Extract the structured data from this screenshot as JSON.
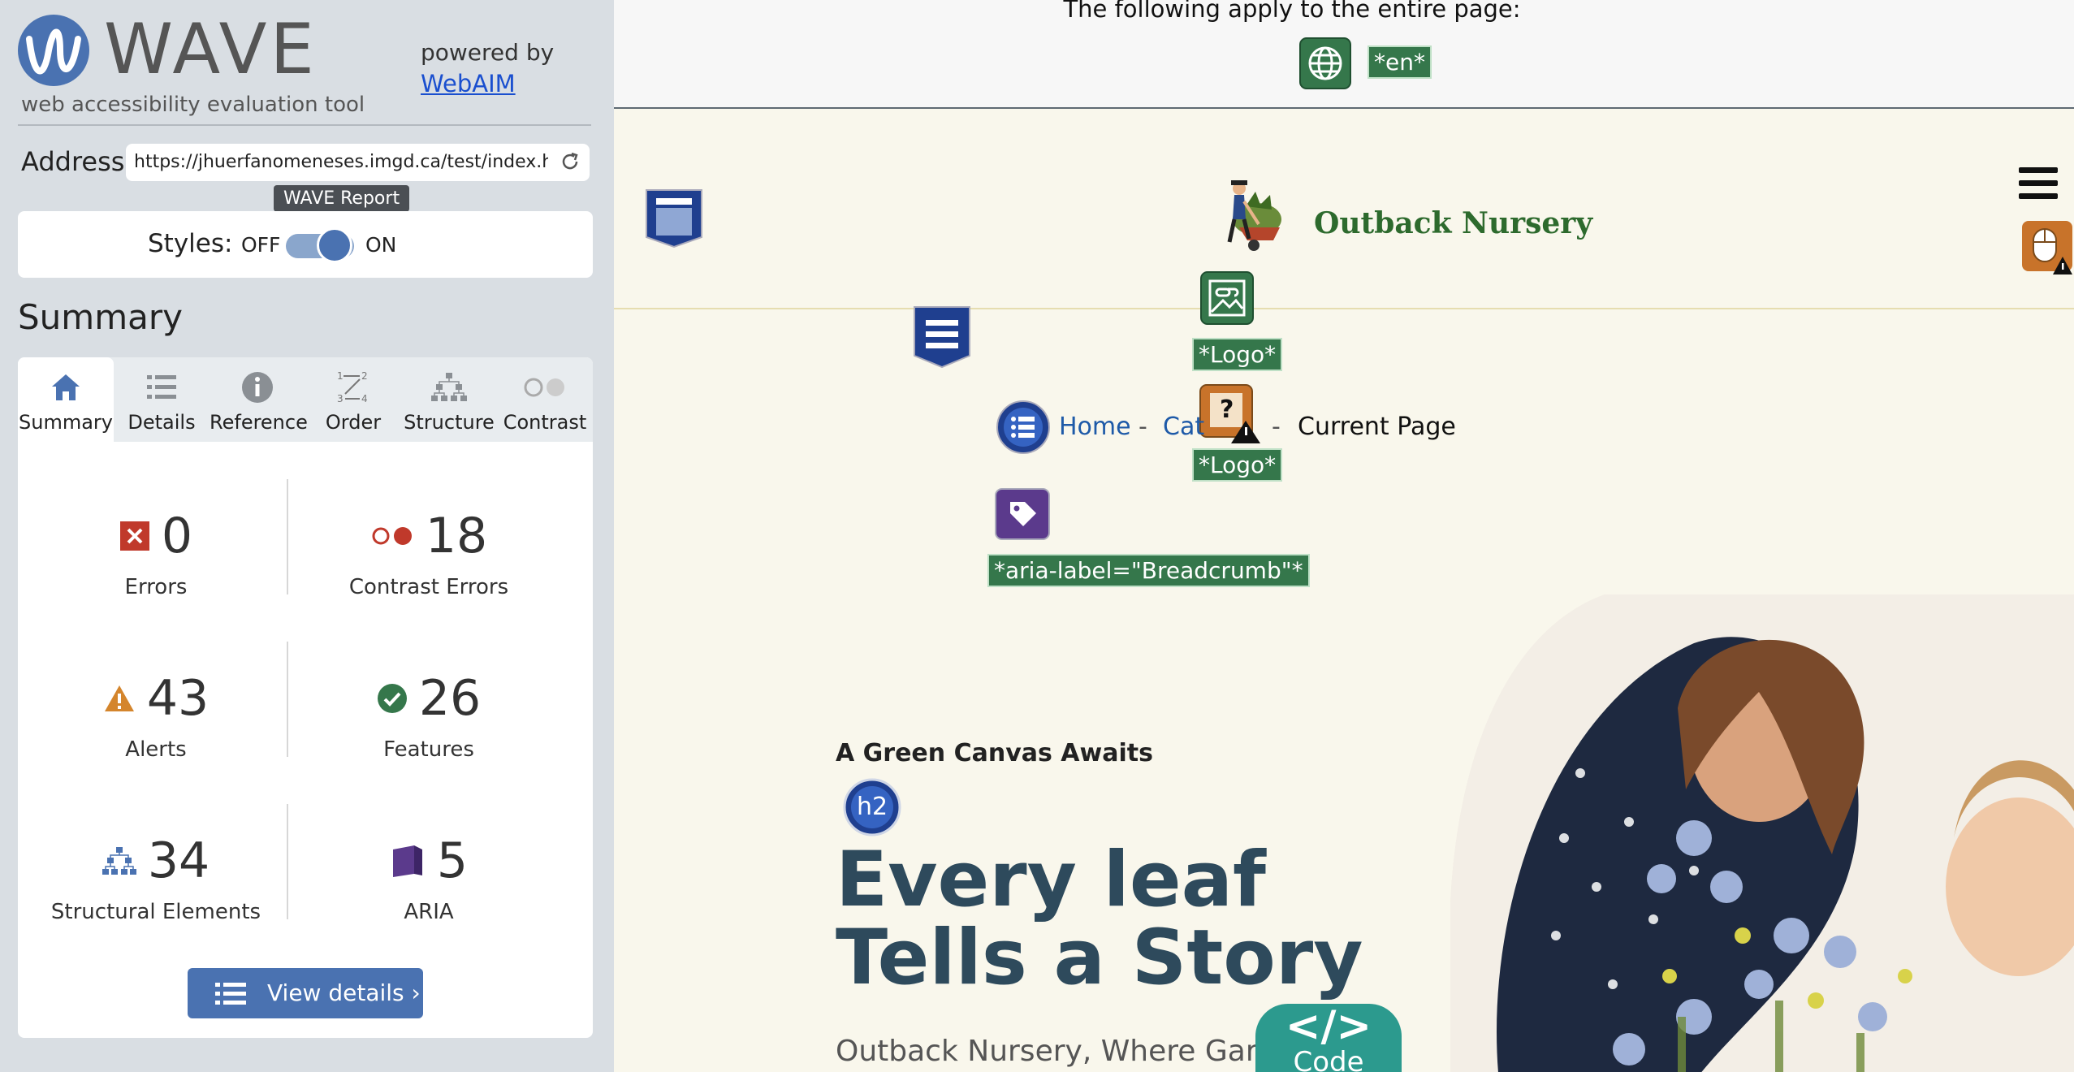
{
  "wave": {
    "brand": "WAVE",
    "subtitle": "web accessibility evaluation tool",
    "powered_by": "powered by",
    "webaim": "WebAIM",
    "address_label": "Address:",
    "address_value": "https://jhuerfanomeneses.imgd.ca/test/index.htm",
    "tooltip": "WAVE Report",
    "styles_label": "Styles:",
    "styles_off": "OFF",
    "styles_on": "ON",
    "summary_heading": "Summary",
    "tabs": [
      {
        "label": "Summary",
        "icon": "home-icon"
      },
      {
        "label": "Details",
        "icon": "list-icon"
      },
      {
        "label": "Reference",
        "icon": "info-icon"
      },
      {
        "label": "Order",
        "icon": "order-icon"
      },
      {
        "label": "Structure",
        "icon": "structure-icon"
      },
      {
        "label": "Contrast",
        "icon": "contrast-icon"
      }
    ],
    "stats": {
      "errors": {
        "value": "0",
        "label": "Errors"
      },
      "contrast_errors": {
        "value": "18",
        "label": "Contrast Errors"
      },
      "alerts": {
        "value": "43",
        "label": "Alerts"
      },
      "features": {
        "value": "26",
        "label": "Features"
      },
      "structural": {
        "value": "34",
        "label": "Structural Elements"
      },
      "aria": {
        "value": "5",
        "label": "ARIA"
      }
    },
    "view_details": "View details ›"
  },
  "page": {
    "apply_text": "The following apply to the entire page:",
    "lang_label": "*en*",
    "brand_name": "Outback Nursery",
    "logo_label_1": "*Logo*",
    "logo_label_2": "*Logo*",
    "breadcrumb": {
      "home": "Home",
      "sep": "-",
      "cat": "Cat",
      "current": "Current Page"
    },
    "aria_label": "*aria-label=\"Breadcrumb\"*",
    "h2_badge": "h2",
    "eyebrow": "A Green Canvas Awaits",
    "headline_line1": "Every leaf",
    "headline_line2": "Tells a Story",
    "tagline": "Outback Nursery, Where Garden",
    "code_symbol": "</>",
    "code_label": "Code"
  },
  "colors": {
    "wave_blue": "#4a72b1",
    "feature_green": "#35774b",
    "error_red": "#c0392b",
    "alert_orange": "#d4852c",
    "aria_purple": "#5b3a8c",
    "page_bg": "#f9f7ec"
  }
}
